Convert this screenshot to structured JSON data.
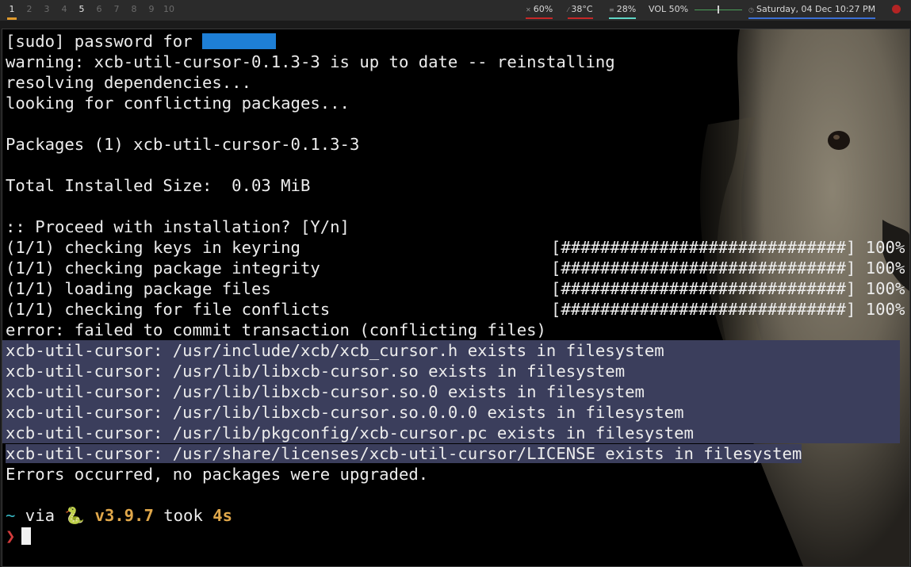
{
  "workspaces": [
    "1",
    "2",
    "3",
    "4",
    "5",
    "6",
    "7",
    "8",
    "9",
    "10"
  ],
  "status": {
    "cpu": "60%",
    "temp": "38°C",
    "mem": "28%",
    "vol_label": "VOL 50%",
    "volume": 0.5,
    "datetime": "Saturday, 04 Dec 10:27 PM",
    "colors": {
      "cpu": "#c62828",
      "temp": "#c62828",
      "mem": "#5fd6c6",
      "date": "#3b6fd4",
      "active_ws": "#e09a2c",
      "power": "#b32424"
    },
    "icons": {
      "cpu": "cpu-icon",
      "temp": "thermometer-icon",
      "mem": "memory-icon",
      "date": "clock-icon",
      "power": "power-icon"
    }
  },
  "terminal": {
    "sudo_prompt": "[sudo] password for ",
    "lines": [
      "warning: xcb-util-cursor-0.1.3-3 is up to date -- reinstalling",
      "resolving dependencies...",
      "looking for conflicting packages...",
      "",
      "Packages (1) xcb-util-cursor-0.1.3-3",
      "",
      "Total Installed Size:  0.03 MiB",
      "",
      ":: Proceed with installation? [Y/n]"
    ],
    "progress": [
      {
        "label": "(1/1) checking keys in keyring",
        "bar": "[#############################] 100%"
      },
      {
        "label": "(1/1) checking package integrity",
        "bar": "[#############################] 100%"
      },
      {
        "label": "(1/1) loading package files",
        "bar": "[#############################] 100%"
      },
      {
        "label": "(1/1) checking for file conflicts",
        "bar": "[#############################] 100%"
      }
    ],
    "error_line": "error: failed to commit transaction (conflicting files)",
    "conflicts": [
      "xcb-util-cursor: /usr/include/xcb/xcb_cursor.h exists in filesystem",
      "xcb-util-cursor: /usr/lib/libxcb-cursor.so exists in filesystem",
      "xcb-util-cursor: /usr/lib/libxcb-cursor.so.0 exists in filesystem",
      "xcb-util-cursor: /usr/lib/libxcb-cursor.so.0.0.0 exists in filesystem",
      "xcb-util-cursor: /usr/lib/pkgconfig/xcb-cursor.pc exists in filesystem",
      "xcb-util-cursor: /usr/share/licenses/xcb-util-cursor/LICENSE exists in filesystem"
    ],
    "summary": "Errors occurred, no packages were upgraded.",
    "prompt": {
      "dir": "~",
      "via": " via ",
      "python_icon": "🐍",
      "version": " v3.9.7",
      "took_label": " took ",
      "duration": "4s",
      "chevron": "❯"
    }
  }
}
